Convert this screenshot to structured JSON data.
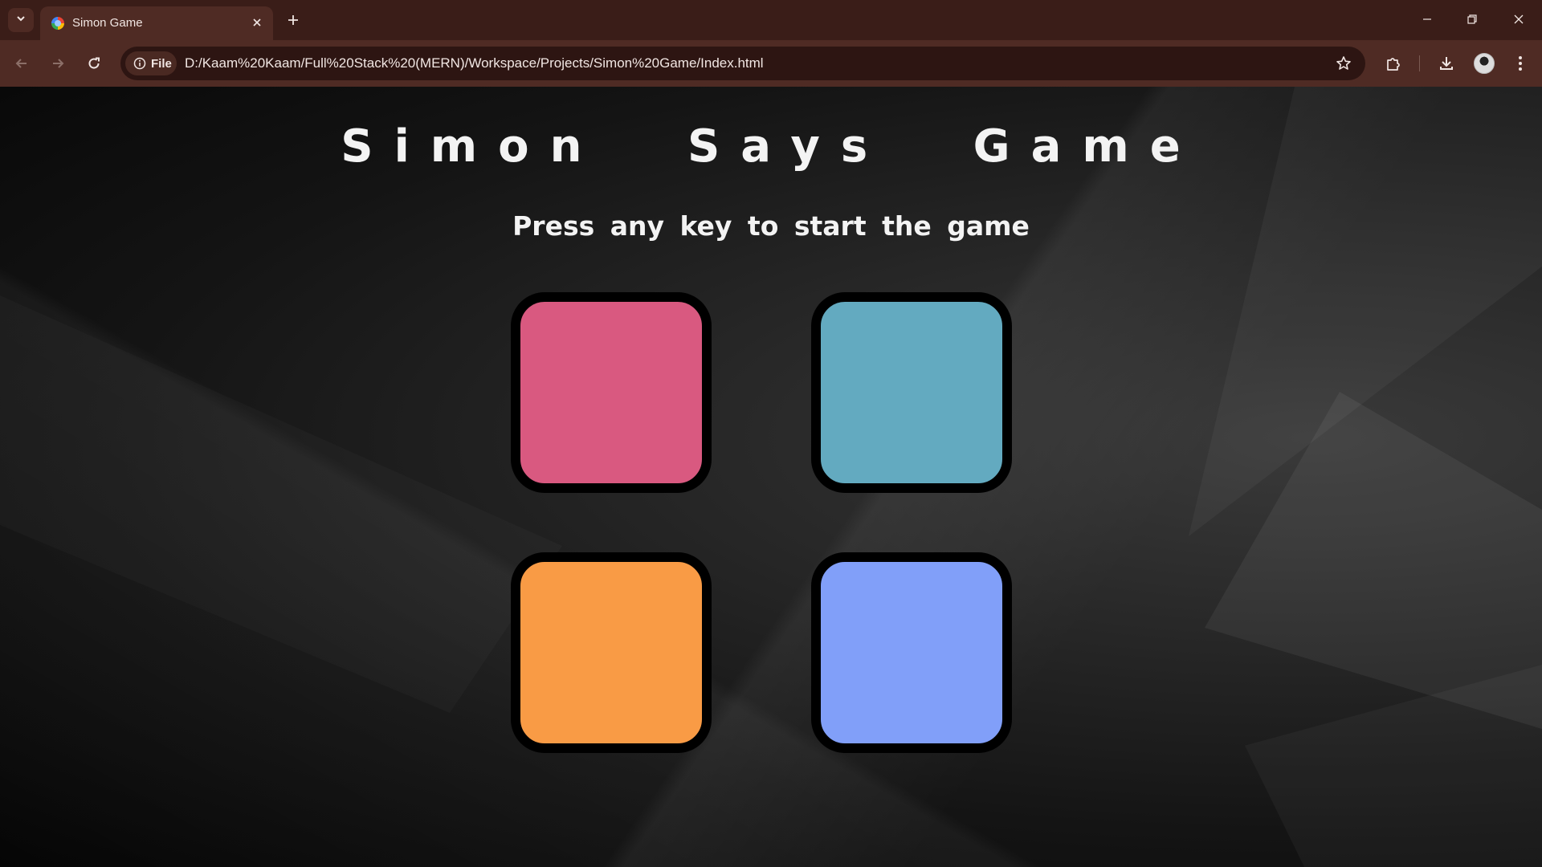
{
  "browser": {
    "tab": {
      "title": "Simon Game"
    },
    "address": {
      "chip_label": "File",
      "url": "D:/Kaam%20Kaam/Full%20Stack%20(MERN)/Workspace/Projects/Simon%20Game/Index.html"
    },
    "colors": {
      "tabstrip": "#3a1d18",
      "toolbar": "#4f2b24",
      "omnibox": "#2d1512"
    }
  },
  "page": {
    "title": "Simon Says Game",
    "status": "Press any key to start the game",
    "buttons": [
      {
        "name": "red",
        "color": "#d95980"
      },
      {
        "name": "teal",
        "color": "#63aac0"
      },
      {
        "name": "orange",
        "color": "#f99b45"
      },
      {
        "name": "blue",
        "color": "#819ff9"
      }
    ]
  }
}
